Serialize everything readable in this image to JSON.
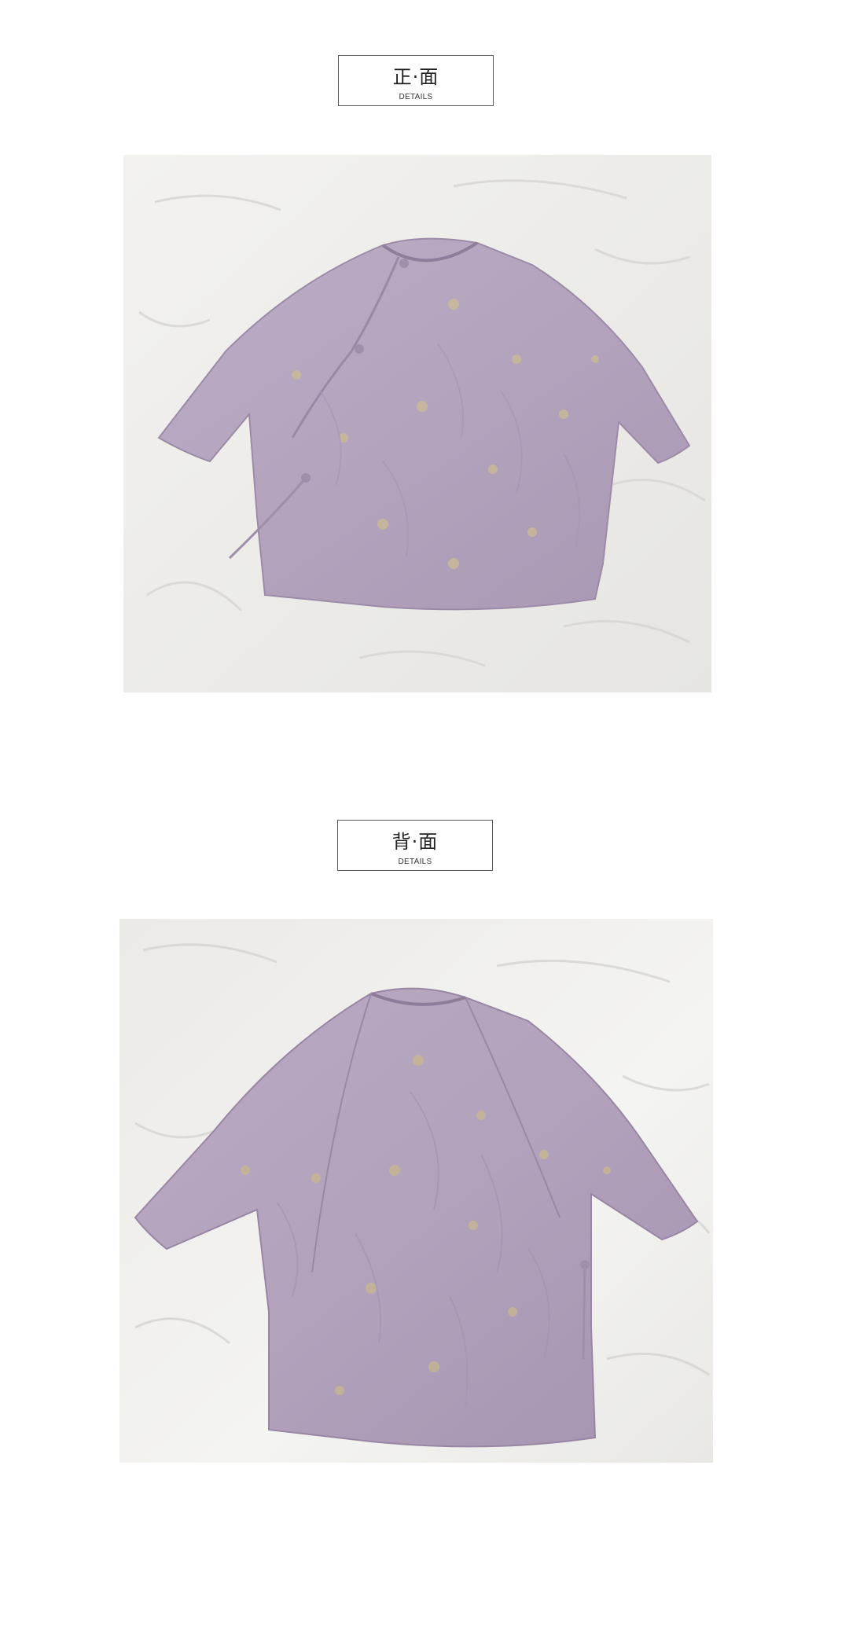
{
  "sections": [
    {
      "title": "正·面",
      "subtitle": "DETAILS",
      "image_subject": "garment-front",
      "colors": {
        "fabric": "#b9a9c2",
        "fabric_shadow": "#9e8da9",
        "pattern": "#c9b98f",
        "background": "#ecebe8"
      }
    },
    {
      "title": "背·面",
      "subtitle": "DETAILS",
      "image_subject": "garment-back",
      "colors": {
        "fabric": "#b7a7c0",
        "fabric_shadow": "#9a89a6",
        "pattern": "#c6b68c",
        "background": "#eeeeec"
      }
    }
  ]
}
